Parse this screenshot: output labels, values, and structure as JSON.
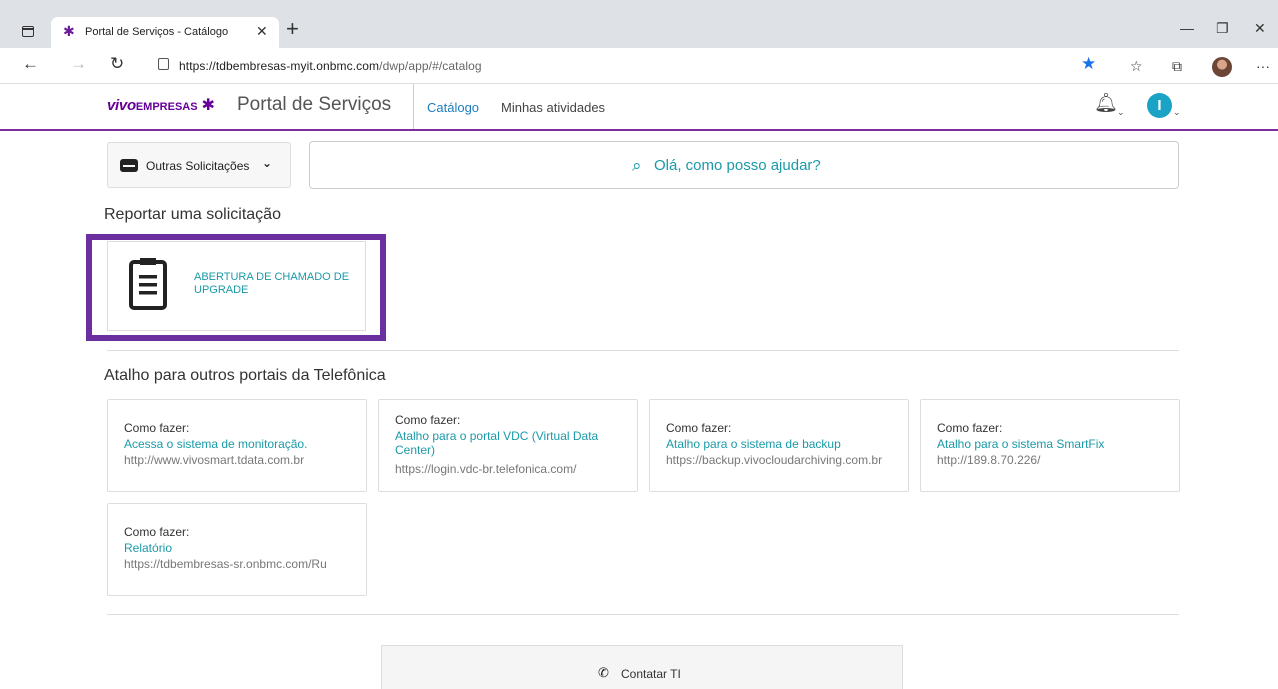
{
  "browser": {
    "tab_title": "Portal de Serviços - Catálogo",
    "url_domain": "https://tdbembresas-myit.onbmc.com",
    "url_path": "/dwp/app/#/catalog"
  },
  "header": {
    "logo_vivo": "vivo",
    "logo_empresas": "EMPRESAS",
    "title": "Portal de Serviços",
    "nav": [
      "Catálogo",
      "Minhas atividades"
    ],
    "avatar_initial": "I"
  },
  "dropdown": {
    "label": "Outras Solicitações"
  },
  "search": {
    "placeholder": "Olá, como posso ajudar?"
  },
  "section_report": {
    "title": "Reportar uma solicitação",
    "card_label": "ABERTURA DE CHAMADO DE UPGRADE"
  },
  "section_shortcuts": {
    "title": "Atalho para outros portais da Telefônica",
    "cards": [
      {
        "head": "Como fazer:",
        "title": "Acessa o sistema de monitoração.",
        "url": "http://www.vivosmart.tdata.com.br"
      },
      {
        "head": "Como fazer:",
        "title": "Atalho para o portal VDC (Virtual Data Center)",
        "url": "https://login.vdc-br.telefonica.com/"
      },
      {
        "head": "Como fazer:",
        "title": "Atalho para o sistema de backup",
        "url": "https://backup.vivocloudarchiving.com.br"
      },
      {
        "head": "Como fazer:",
        "title": "Atalho para o sistema SmartFix",
        "url": "http://189.8.70.226/"
      },
      {
        "head": "Como fazer:",
        "title": "Relatório",
        "url": "https://tdbembresas-sr.onbmc.com/Ru"
      }
    ]
  },
  "contact": {
    "label": "Contatar TI"
  },
  "colors": {
    "brand_purple": "#660099",
    "accent_teal": "#1a9aa8",
    "highlight": "#6b2fa0"
  }
}
